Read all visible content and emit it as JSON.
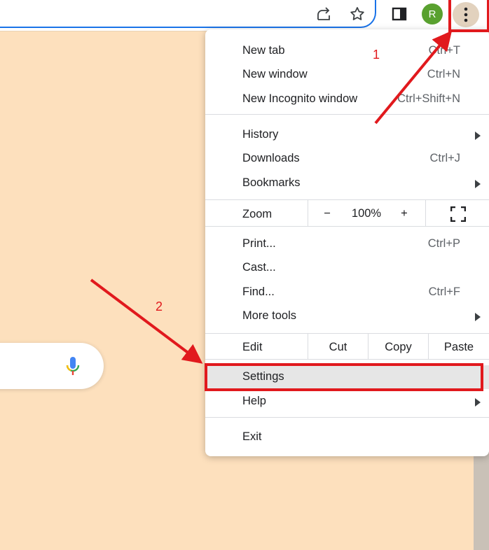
{
  "toolbar": {
    "share_icon": "share-icon",
    "star_icon": "star-icon",
    "side_panel_icon": "side-panel-icon",
    "avatar_initial": "R",
    "menu_icon": "three-dots-vertical-icon"
  },
  "page": {
    "background_color": "#fde0bd",
    "search": {
      "mic_icon": "microphone-icon"
    }
  },
  "menu": {
    "new_tab": {
      "label": "New tab",
      "shortcut": "Ctrl+T"
    },
    "new_window": {
      "label": "New window",
      "shortcut": "Ctrl+N"
    },
    "new_incognito": {
      "label": "New Incognito window",
      "shortcut": "Ctrl+Shift+N"
    },
    "history": {
      "label": "History"
    },
    "downloads": {
      "label": "Downloads",
      "shortcut": "Ctrl+J"
    },
    "bookmarks": {
      "label": "Bookmarks"
    },
    "zoom": {
      "label": "Zoom",
      "minus": "−",
      "value": "100%",
      "plus": "+",
      "fullscreen_icon": "fullscreen-icon"
    },
    "print": {
      "label": "Print...",
      "shortcut": "Ctrl+P"
    },
    "cast": {
      "label": "Cast..."
    },
    "find": {
      "label": "Find...",
      "shortcut": "Ctrl+F"
    },
    "more_tools": {
      "label": "More tools"
    },
    "edit": {
      "label": "Edit",
      "cut": "Cut",
      "copy": "Copy",
      "paste": "Paste"
    },
    "settings": {
      "label": "Settings"
    },
    "help": {
      "label": "Help"
    },
    "exit": {
      "label": "Exit"
    }
  },
  "annotations": {
    "step1": "1",
    "step2": "2",
    "color": "#e1191d"
  }
}
